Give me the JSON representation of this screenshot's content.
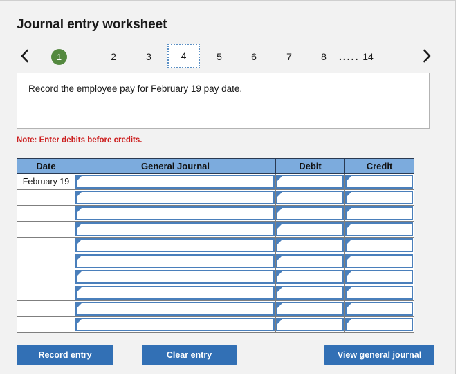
{
  "header": {
    "title": "Journal entry worksheet"
  },
  "pager": {
    "prev_icon": "chevron-left-icon",
    "next_icon": "chevron-right-icon",
    "ellipsis": ".....",
    "current_page": "1",
    "selected_page": "4",
    "pages": [
      "1",
      "2",
      "3",
      "4",
      "5",
      "6",
      "7",
      "8",
      "14"
    ],
    "current_color": "#54893f",
    "selected_border_color": "#5a8fc4"
  },
  "description": {
    "text": "Record the employee pay for February 19 pay date."
  },
  "note": {
    "text": "Note: Enter debits before credits.",
    "color": "#cc1f1f"
  },
  "table": {
    "columns": [
      "Date",
      "General Journal",
      "Debit",
      "Credit"
    ],
    "header_bg": "#7cabdd",
    "input_border_color": "#4a7fbb",
    "rows": [
      {
        "date": "February 19",
        "general_journal": "",
        "debit": "",
        "credit": ""
      },
      {
        "date": "",
        "general_journal": "",
        "debit": "",
        "credit": ""
      },
      {
        "date": "",
        "general_journal": "",
        "debit": "",
        "credit": ""
      },
      {
        "date": "",
        "general_journal": "",
        "debit": "",
        "credit": ""
      },
      {
        "date": "",
        "general_journal": "",
        "debit": "",
        "credit": ""
      },
      {
        "date": "",
        "general_journal": "",
        "debit": "",
        "credit": ""
      },
      {
        "date": "",
        "general_journal": "",
        "debit": "",
        "credit": ""
      },
      {
        "date": "",
        "general_journal": "",
        "debit": "",
        "credit": ""
      },
      {
        "date": "",
        "general_journal": "",
        "debit": "",
        "credit": ""
      },
      {
        "date": "",
        "general_journal": "",
        "debit": "",
        "credit": ""
      }
    ]
  },
  "buttons": {
    "record": "Record entry",
    "clear": "Clear entry",
    "view": "View general journal",
    "color": "#3270b5"
  }
}
